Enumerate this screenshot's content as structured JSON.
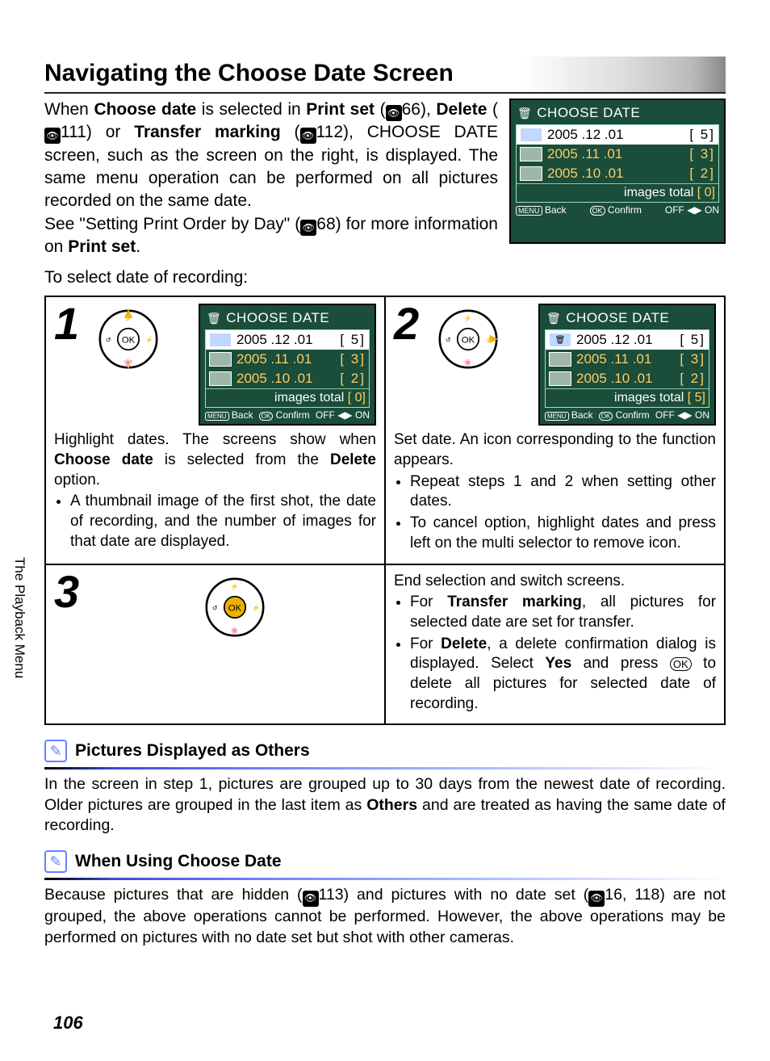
{
  "section_title": "Navigating the Choose Date Screen",
  "intro": {
    "p1_a": "When ",
    "p1_b": "Choose date",
    "p1_c": " is selected in ",
    "p1_d": "Print set",
    "p1_e": " (",
    "p1_ref1": "66",
    "p1_f": "), ",
    "p1_g": "Delete",
    "p1_h": " (",
    "p1_ref2": "111",
    "p1_i": ") or ",
    "p1_j": "Transfer marking",
    "p1_k": " (",
    "p1_ref3": "112",
    "p1_l": "), CHOOSE DATE screen, such as the screen on the right, is displayed. The same menu operation can be performed on all pictures recorded on the same date.",
    "p2_a": "See \"Setting Print Order by Day\" (",
    "p2_ref": "68",
    "p2_b": ") for more information on ",
    "p2_c": "Print set",
    "p2_d": "."
  },
  "select_line": "To select date of recording:",
  "lcd_main": {
    "title": "CHOOSE DATE",
    "rows": [
      {
        "date": "2005 .12 .01",
        "count": "5"
      },
      {
        "date": "2005 .11 .01",
        "count": "3"
      },
      {
        "date": "2005 .10 .01",
        "count": "2"
      }
    ],
    "summary_label": "images total",
    "summary_count": "0",
    "footer_back": "Back",
    "footer_confirm": "Confirm",
    "footer_off": "OFF",
    "footer_on": "ON",
    "footer_menu": "MENU",
    "footer_ok": "OK"
  },
  "step1": {
    "num": "1",
    "lcd_summary_count": "0",
    "body_a": "Highlight dates. The screens show when ",
    "body_b": "Choose date",
    "body_c": " is selected from the ",
    "body_d": "Delete",
    "body_e": " option.",
    "bullet": "A thumbnail image of the first shot, the date of recording, and the number of images for that date are displayed."
  },
  "step2": {
    "num": "2",
    "lcd_summary_count": "5",
    "body": "Set date. An icon corresponding to the function appears.",
    "bullet1": "Repeat steps 1 and 2 when setting other dates.",
    "bullet2": "To cancel option, highlight dates and press left on the multi selector to remove icon."
  },
  "step3": {
    "num": "3",
    "body_a": "End selection and switch screens.",
    "bullet1_a": "For ",
    "bullet1_b": "Transfer marking",
    "bullet1_c": ", all pictures for selected date are set for transfer.",
    "bullet2_a": "For ",
    "bullet2_b": "Delete",
    "bullet2_c": ", a delete confirmation dialog is displayed. Select ",
    "bullet2_d": "Yes",
    "bullet2_e": " and press ",
    "bullet2_ok": "OK",
    "bullet2_f": " to delete all pictures for selected date of recording."
  },
  "sidebar": "The Playback Menu",
  "note1": {
    "title": "Pictures Displayed as Others",
    "body_a": "In the screen in step 1, pictures are grouped up to 30 days from the newest date of recording. Older pictures are grouped in the last item as ",
    "body_b": "Others",
    "body_c": " and are treated as having the same date of recording."
  },
  "note2": {
    "title": "When Using Choose Date",
    "body_a": "Because pictures that are hidden (",
    "body_ref1": "113",
    "body_b": ") and pictures with no date set (",
    "body_ref2": "16, 118",
    "body_c": ") are not grouped, the above operations cannot be performed. However, the above operations may be performed on pictures with no date set but shot with other cameras."
  },
  "page_number": "106"
}
